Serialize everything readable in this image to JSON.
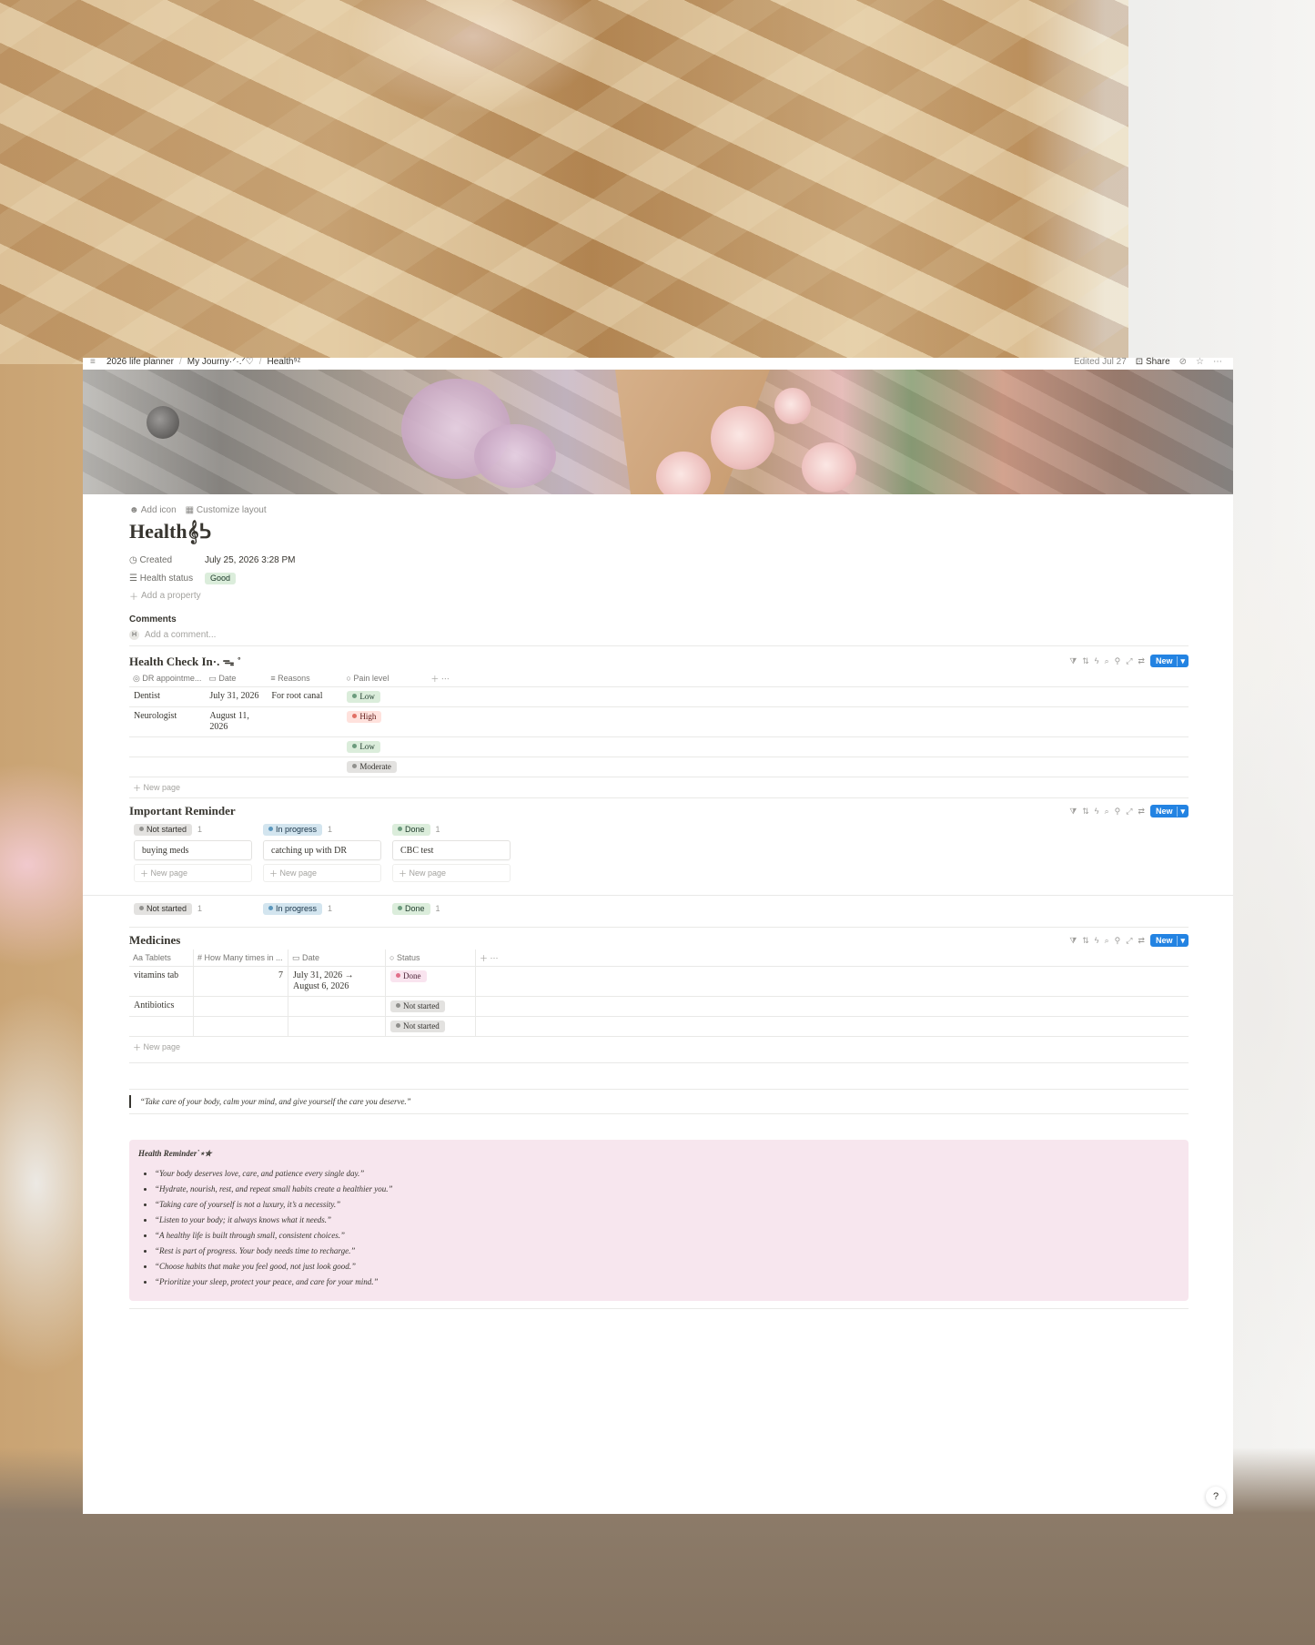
{
  "breadcrumb": {
    "items": [
      "2026 life planner",
      "My Journy·ᐟ·.ᐟ♡",
      "Health⁹ᶻ"
    ],
    "separator": "/"
  },
  "topbar": {
    "edited": "Edited Jul 27",
    "share": "Share"
  },
  "page": {
    "add_icon": "Add icon",
    "customize_layout": "Customize layout",
    "title": "Health𝄞ᕊ",
    "properties": [
      {
        "key": "Created",
        "value": "July 25, 2026 3:28 PM"
      },
      {
        "key": "Health status",
        "value": "Good"
      }
    ],
    "add_property": "Add a property",
    "comments_heading": "Comments",
    "comment_avatar": "H",
    "comment_placeholder": "Add a comment..."
  },
  "health_check": {
    "title": "Health Check In·. ᯓ ˚",
    "new_label": "New",
    "columns": [
      "DR appointme...",
      "Date",
      "Reasons",
      "Pain level"
    ],
    "rows": [
      {
        "dr": "Dentist",
        "date": "July 31, 2026",
        "reason": "For root canal",
        "pain": "Low"
      },
      {
        "dr": "Neurologist",
        "date": "August 11, 2026",
        "reason": "",
        "pain": "High"
      },
      {
        "dr": "",
        "date": "",
        "reason": "",
        "pain": "Low"
      },
      {
        "dr": "",
        "date": "",
        "reason": "",
        "pain": "Moderate"
      }
    ],
    "new_page": "New page"
  },
  "reminder": {
    "title": "Important Reminder",
    "new_label": "New",
    "columns": [
      {
        "status": "Not started",
        "count": "1",
        "card": "buying meds",
        "new_page": "New page"
      },
      {
        "status": "In progress",
        "count": "1",
        "card": "catching up with DR",
        "new_page": "New page"
      },
      {
        "status": "Done",
        "count": "1",
        "card": "CBC test",
        "new_page": "New page"
      }
    ],
    "sticky_header": [
      {
        "status": "Not started",
        "count": "1"
      },
      {
        "status": "In progress",
        "count": "1"
      },
      {
        "status": "Done",
        "count": "1"
      }
    ]
  },
  "medicines": {
    "title": "Medicines",
    "new_label": "New",
    "columns": [
      "Tablets",
      "How Many times in ...",
      "Date",
      "Status"
    ],
    "rows": [
      {
        "tablet": "vitamins tab",
        "times": "7",
        "date": "July 31, 2026 → August 6, 2026",
        "status": "Done"
      },
      {
        "tablet": "Antibiotics",
        "times": "",
        "date": "",
        "status": "Not started"
      },
      {
        "tablet": "",
        "times": "",
        "date": "",
        "status": "Not started"
      }
    ],
    "new_page": "New page"
  },
  "quote": "“Take care of your body, calm your mind, and give yourself the care you deserve.”",
  "callout": {
    "title": "Health Reminder˙⋆✮",
    "items": [
      "“Your body deserves love, care, and patience every single day.”",
      "“Hydrate, nourish, rest, and repeat  small habits create a healthier you.”",
      "“Taking care of yourself is not a luxury, it’s a necessity.”",
      "“Listen to your body; it always knows what it needs.”",
      "“A healthy life is built through small, consistent choices.”",
      "“Rest is part of progress. Your body needs time to recharge.”",
      "“Choose habits that make you feel good, not just look good.”",
      "“Prioritize your sleep, protect your peace, and care for your mind.”"
    ]
  },
  "help_label": "?",
  "colors": {
    "accent": "#2383e2",
    "callout_bg": "#f7e6ee",
    "tag_green": "#dbeddb",
    "tag_red": "#ffe2dd",
    "tag_gray": "#e3e2e0",
    "tag_blue": "#d3e5ef"
  }
}
